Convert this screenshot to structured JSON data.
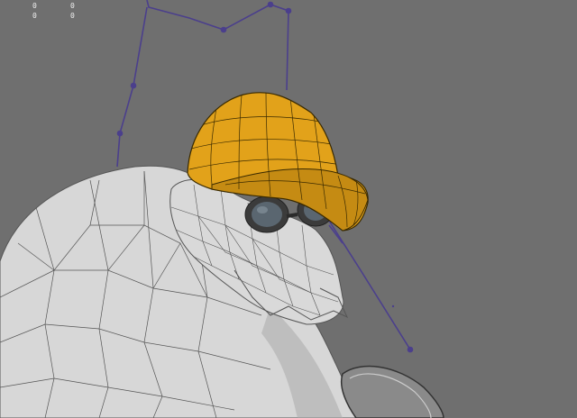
{
  "hud": {
    "values": [
      {
        "label": "0"
      },
      {
        "label": "0"
      },
      {
        "label": "0"
      },
      {
        "label": "0"
      }
    ]
  },
  "colors": {
    "background": "#6f6f6f",
    "mesh_fill": "#d7d7d7",
    "mesh_shadow": "#a9a9a9",
    "wire": "#4a4a4a",
    "cap": "#e2a21a",
    "cap_shadow": "#b57d0c",
    "rig": "#4b3f8c",
    "goggle_frame": "#3b3b3b",
    "goggle_lens": "#5a6670"
  },
  "icons": {
    "rig_joint": "joint-icon"
  }
}
